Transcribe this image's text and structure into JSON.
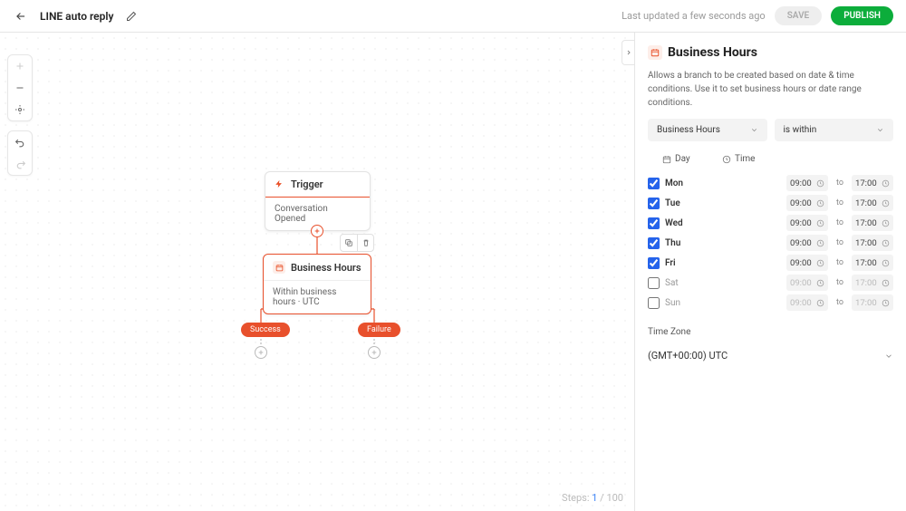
{
  "header": {
    "title": "LINE auto reply",
    "last_updated": "Last updated a few seconds ago",
    "save_label": "SAVE",
    "publish_label": "PUBLISH"
  },
  "canvas": {
    "trigger": {
      "label": "Trigger",
      "body": "Conversation Opened"
    },
    "business_hours_node": {
      "label": "Business Hours",
      "body": "Within business hours · UTC"
    },
    "success_label": "Success",
    "failure_label": "Failure",
    "steps_prefix": "Steps:",
    "steps_current": "1",
    "steps_total": "/ 100"
  },
  "panel": {
    "title": "Business Hours",
    "description": "Allows a branch to be created based on date & time conditions. Use it to set business hours or date range conditions.",
    "dropdown_type": "Business Hours",
    "dropdown_condition": "is within",
    "col_day": "Day",
    "col_time": "Time",
    "to_label": "to",
    "days": [
      {
        "key": "mon",
        "label": "Mon",
        "checked": true,
        "start": "09:00",
        "end": "17:00"
      },
      {
        "key": "tue",
        "label": "Tue",
        "checked": true,
        "start": "09:00",
        "end": "17:00"
      },
      {
        "key": "wed",
        "label": "Wed",
        "checked": true,
        "start": "09:00",
        "end": "17:00"
      },
      {
        "key": "thu",
        "label": "Thu",
        "checked": true,
        "start": "09:00",
        "end": "17:00"
      },
      {
        "key": "fri",
        "label": "Fri",
        "checked": true,
        "start": "09:00",
        "end": "17:00"
      },
      {
        "key": "sat",
        "label": "Sat",
        "checked": false,
        "start": "09:00",
        "end": "17:00"
      },
      {
        "key": "sun",
        "label": "Sun",
        "checked": false,
        "start": "09:00",
        "end": "17:00"
      }
    ],
    "timezone_label": "Time Zone",
    "timezone_value": "(GMT+00:00) UTC"
  }
}
